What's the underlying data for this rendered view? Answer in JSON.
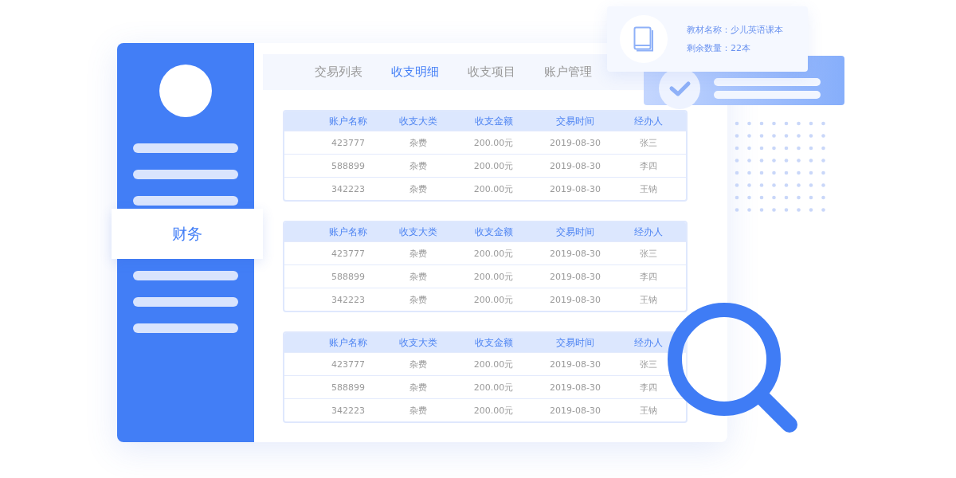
{
  "tabs": [
    {
      "label": "交易列表",
      "selected": false
    },
    {
      "label": "收支明细",
      "selected": true
    },
    {
      "label": "收支项目",
      "selected": false
    },
    {
      "label": "账户管理",
      "selected": false
    }
  ],
  "sidebar": {
    "active_item": {
      "label": "财务"
    }
  },
  "tables": [
    {
      "columns": [
        "账户名称",
        "收支大类",
        "收支金额",
        "交易时间",
        "经办人"
      ],
      "rows": [
        [
          "423777",
          "杂费",
          "200.00元",
          "2019-08-30",
          "张三"
        ],
        [
          "588899",
          "杂费",
          "200.00元",
          "2019-08-30",
          "李四"
        ],
        [
          "342223",
          "杂费",
          "200.00元",
          "2019-08-30",
          "王钠"
        ]
      ]
    },
    {
      "columns": [
        "账户名称",
        "收支大类",
        "收支金额",
        "交易时间",
        "经办人"
      ],
      "rows": [
        [
          "423777",
          "杂费",
          "200.00元",
          "2019-08-30",
          "张三"
        ],
        [
          "588899",
          "杂费",
          "200.00元",
          "2019-08-30",
          "李四"
        ],
        [
          "342223",
          "杂费",
          "200.00元",
          "2019-08-30",
          "王钠"
        ]
      ]
    },
    {
      "columns": [
        "账户名称",
        "收支大类",
        "收支金额",
        "交易时间",
        "经办人"
      ],
      "rows": [
        [
          "423777",
          "杂费",
          "200.00元",
          "2019-08-30",
          "张三"
        ],
        [
          "588899",
          "杂费",
          "200.00元",
          "2019-08-30",
          "李四"
        ],
        [
          "342223",
          "杂费",
          "200.00元",
          "2019-08-30",
          "王钠"
        ]
      ]
    }
  ],
  "info_card": {
    "lines": [
      "教材名称：少儿英语课本",
      "剩余数量：22本"
    ]
  }
}
